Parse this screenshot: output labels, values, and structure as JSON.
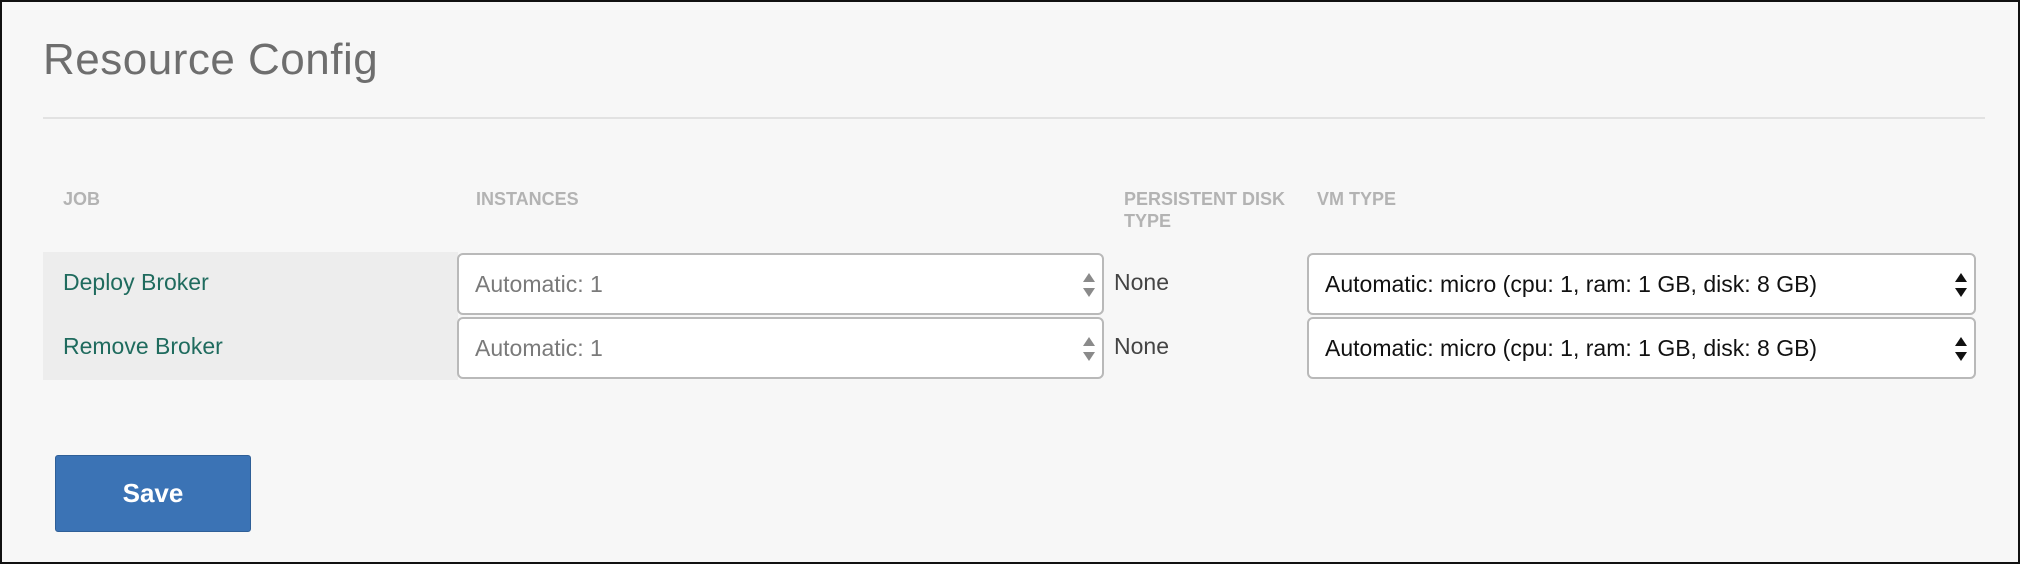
{
  "page": {
    "title": "Resource Config"
  },
  "table": {
    "headers": {
      "job": "JOB",
      "instances": "INSTANCES",
      "persistent_disk_type": "PERSISTENT DISK TYPE",
      "vm_type": "VM TYPE"
    },
    "rows": [
      {
        "job": "Deploy Broker",
        "instances": "Automatic: 1",
        "persistent_disk_type": "None",
        "vm_type": "Automatic: micro (cpu: 1, ram: 1 GB, disk: 8 GB)"
      },
      {
        "job": "Remove Broker",
        "instances": "Automatic: 1",
        "persistent_disk_type": "None",
        "vm_type": "Automatic: micro (cpu: 1, ram: 1 GB, disk: 8 GB)"
      }
    ]
  },
  "actions": {
    "save_label": "Save"
  },
  "icons": {
    "select_arrows": "updown-arrows-icon"
  },
  "colors": {
    "job_link": "#1f6b5e",
    "save_button": "#3b73b5",
    "header_text": "#b3b3b3"
  }
}
